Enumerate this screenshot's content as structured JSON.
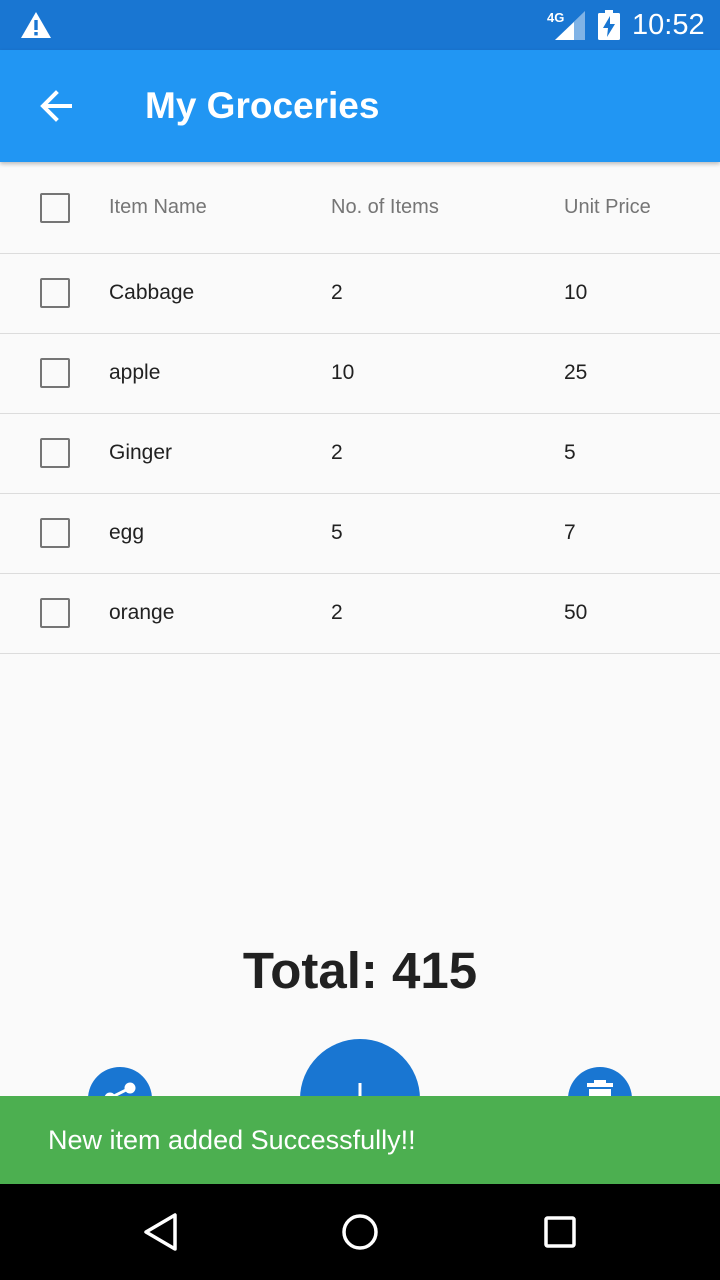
{
  "status_bar": {
    "network": "4G",
    "time": "10:52",
    "icons": [
      "warning-icon",
      "signal-icon",
      "battery-charging-icon"
    ]
  },
  "app_bar": {
    "title": "My Groceries",
    "back_icon": "arrow-back-icon"
  },
  "table": {
    "headers": {
      "name": "Item Name",
      "qty": "No. of Items",
      "price": "Unit Price"
    },
    "rows": [
      {
        "name": "Cabbage",
        "qty": "2",
        "price": "10"
      },
      {
        "name": "apple",
        "qty": "10",
        "price": "25"
      },
      {
        "name": "Ginger",
        "qty": "2",
        "price": "5"
      },
      {
        "name": "egg",
        "qty": "5",
        "price": "7"
      },
      {
        "name": "orange",
        "qty": "2",
        "price": "50"
      }
    ]
  },
  "total": {
    "text": "Total: 415"
  },
  "actions": {
    "share_icon": "share-icon",
    "add_icon": "add-icon",
    "delete_icon": "delete-icon"
  },
  "snackbar": {
    "message": "New item added Successfully!!"
  },
  "nav_bar": {
    "icons": [
      "back-triangle-icon",
      "home-circle-icon",
      "recents-square-icon"
    ]
  },
  "colors": {
    "status_bar": "#1976d2",
    "app_bar": "#2196f3",
    "fab": "#1976d2",
    "snackbar": "#4caf50"
  }
}
